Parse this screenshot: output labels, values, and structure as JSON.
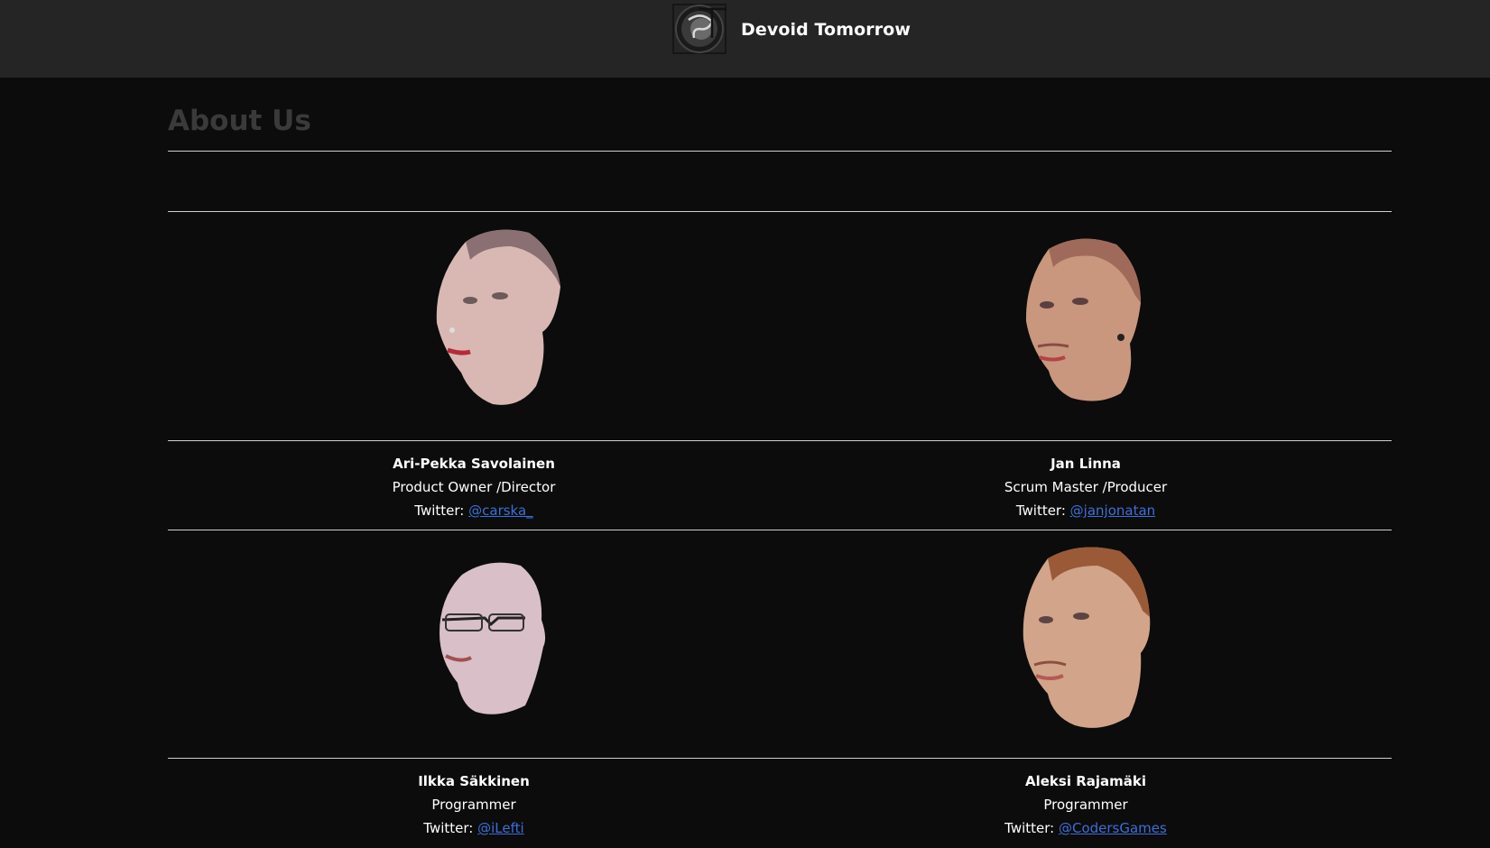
{
  "header": {
    "brand_name": "Devoid Tomorrow",
    "logo_icon": "devoid-tomorrow-logo"
  },
  "page": {
    "title": "About Us"
  },
  "members": [
    {
      "name": "Ari-Pekka Savolainen",
      "role": "Product Owner /Director",
      "twitter_label": "Twitter: ",
      "twitter_handle": "@carska_"
    },
    {
      "name": "Jan Linna",
      "role": "Scrum Master /Producer",
      "twitter_label": "Twitter: ",
      "twitter_handle": "@janjonatan"
    },
    {
      "name": "Ilkka Säkkinen",
      "role": "Programmer",
      "twitter_label": "Twitter: ",
      "twitter_handle": "@iLefti"
    },
    {
      "name": "Aleksi Rajamäki",
      "role": "Programmer",
      "twitter_label": "Twitter: ",
      "twitter_handle": "@CodersGames"
    }
  ],
  "colors": {
    "page_background": "#0c0c0c",
    "navbar_background": "#252525",
    "title_color": "#3a3a3a",
    "link_color": "#3b6fd8",
    "rule_color": "#cfcfcf"
  }
}
